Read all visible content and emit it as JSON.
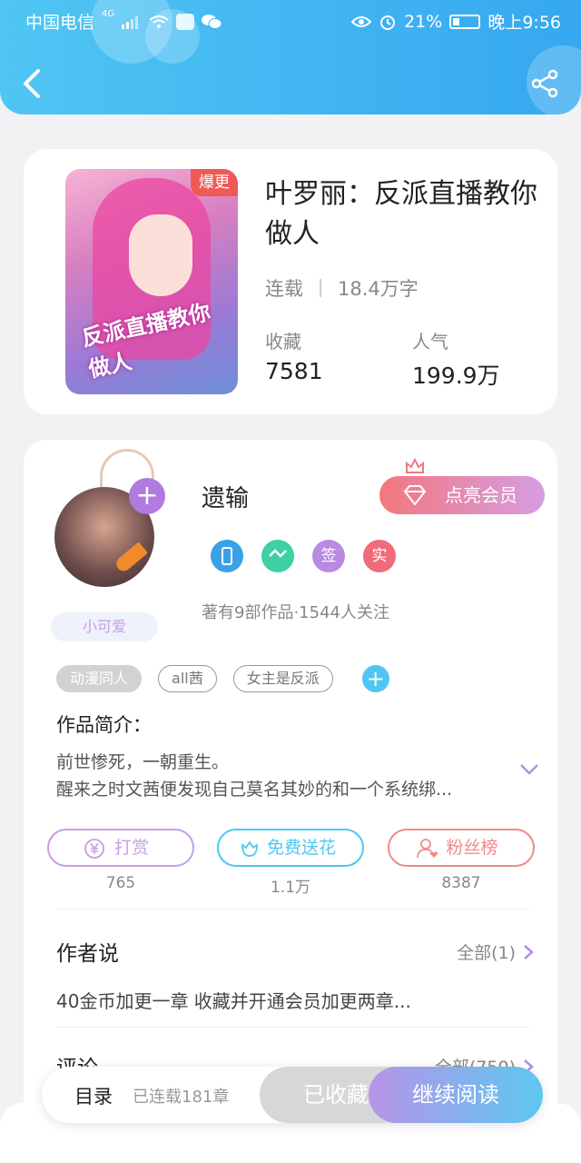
{
  "status_bar": {
    "carrier": "中国电信",
    "network": "4G",
    "battery": "21%",
    "time": "晚上9:56"
  },
  "book": {
    "hot_tag": "爆更",
    "title": "叶罗丽：反派直播教你做人",
    "cover_title": "反派直播教你做人",
    "status": "连载",
    "word_count": "18.4万字",
    "favorites_label": "收藏",
    "favorites_value": "7581",
    "popularity_label": "人气",
    "popularity_value": "199.9万"
  },
  "author": {
    "name": "遗输",
    "title_badge": "小可爱",
    "vip_button": "点亮会员",
    "badges": [
      {
        "text": "",
        "color": "#3aa0e8"
      },
      {
        "text": "",
        "color": "#3ecfa5"
      },
      {
        "text": "签",
        "color": "#b98ae3"
      },
      {
        "text": "实",
        "color": "#f26b7a"
      }
    ],
    "works_info": "著有9部作品·1544人关注"
  },
  "tags": [
    "动漫同人",
    "all茜",
    "女主是反派"
  ],
  "intro": {
    "title": "作品简介：",
    "line1": "前世惨死，一朝重生。",
    "line2": "醒来之时文茜便发现自己莫名其妙的和一个系统绑..."
  },
  "actions": [
    {
      "label": "打赏",
      "count": "765",
      "color": "#c59ee6"
    },
    {
      "label": "免费送花",
      "count": "1.1万",
      "color": "#4fc6f3"
    },
    {
      "label": "粉丝榜",
      "count": "8387",
      "color": "#f08a8a"
    }
  ],
  "author_says": {
    "title": "作者说",
    "more": "全部(1)",
    "text": "40金币加更一章 收藏并开通会员加更两章..."
  },
  "comments": {
    "title": "评论",
    "more": "全部(750)"
  },
  "bottom_bar": {
    "toc": "目录",
    "chapters": "已连载181章",
    "collected": "已收藏",
    "continue": "继续阅读"
  }
}
